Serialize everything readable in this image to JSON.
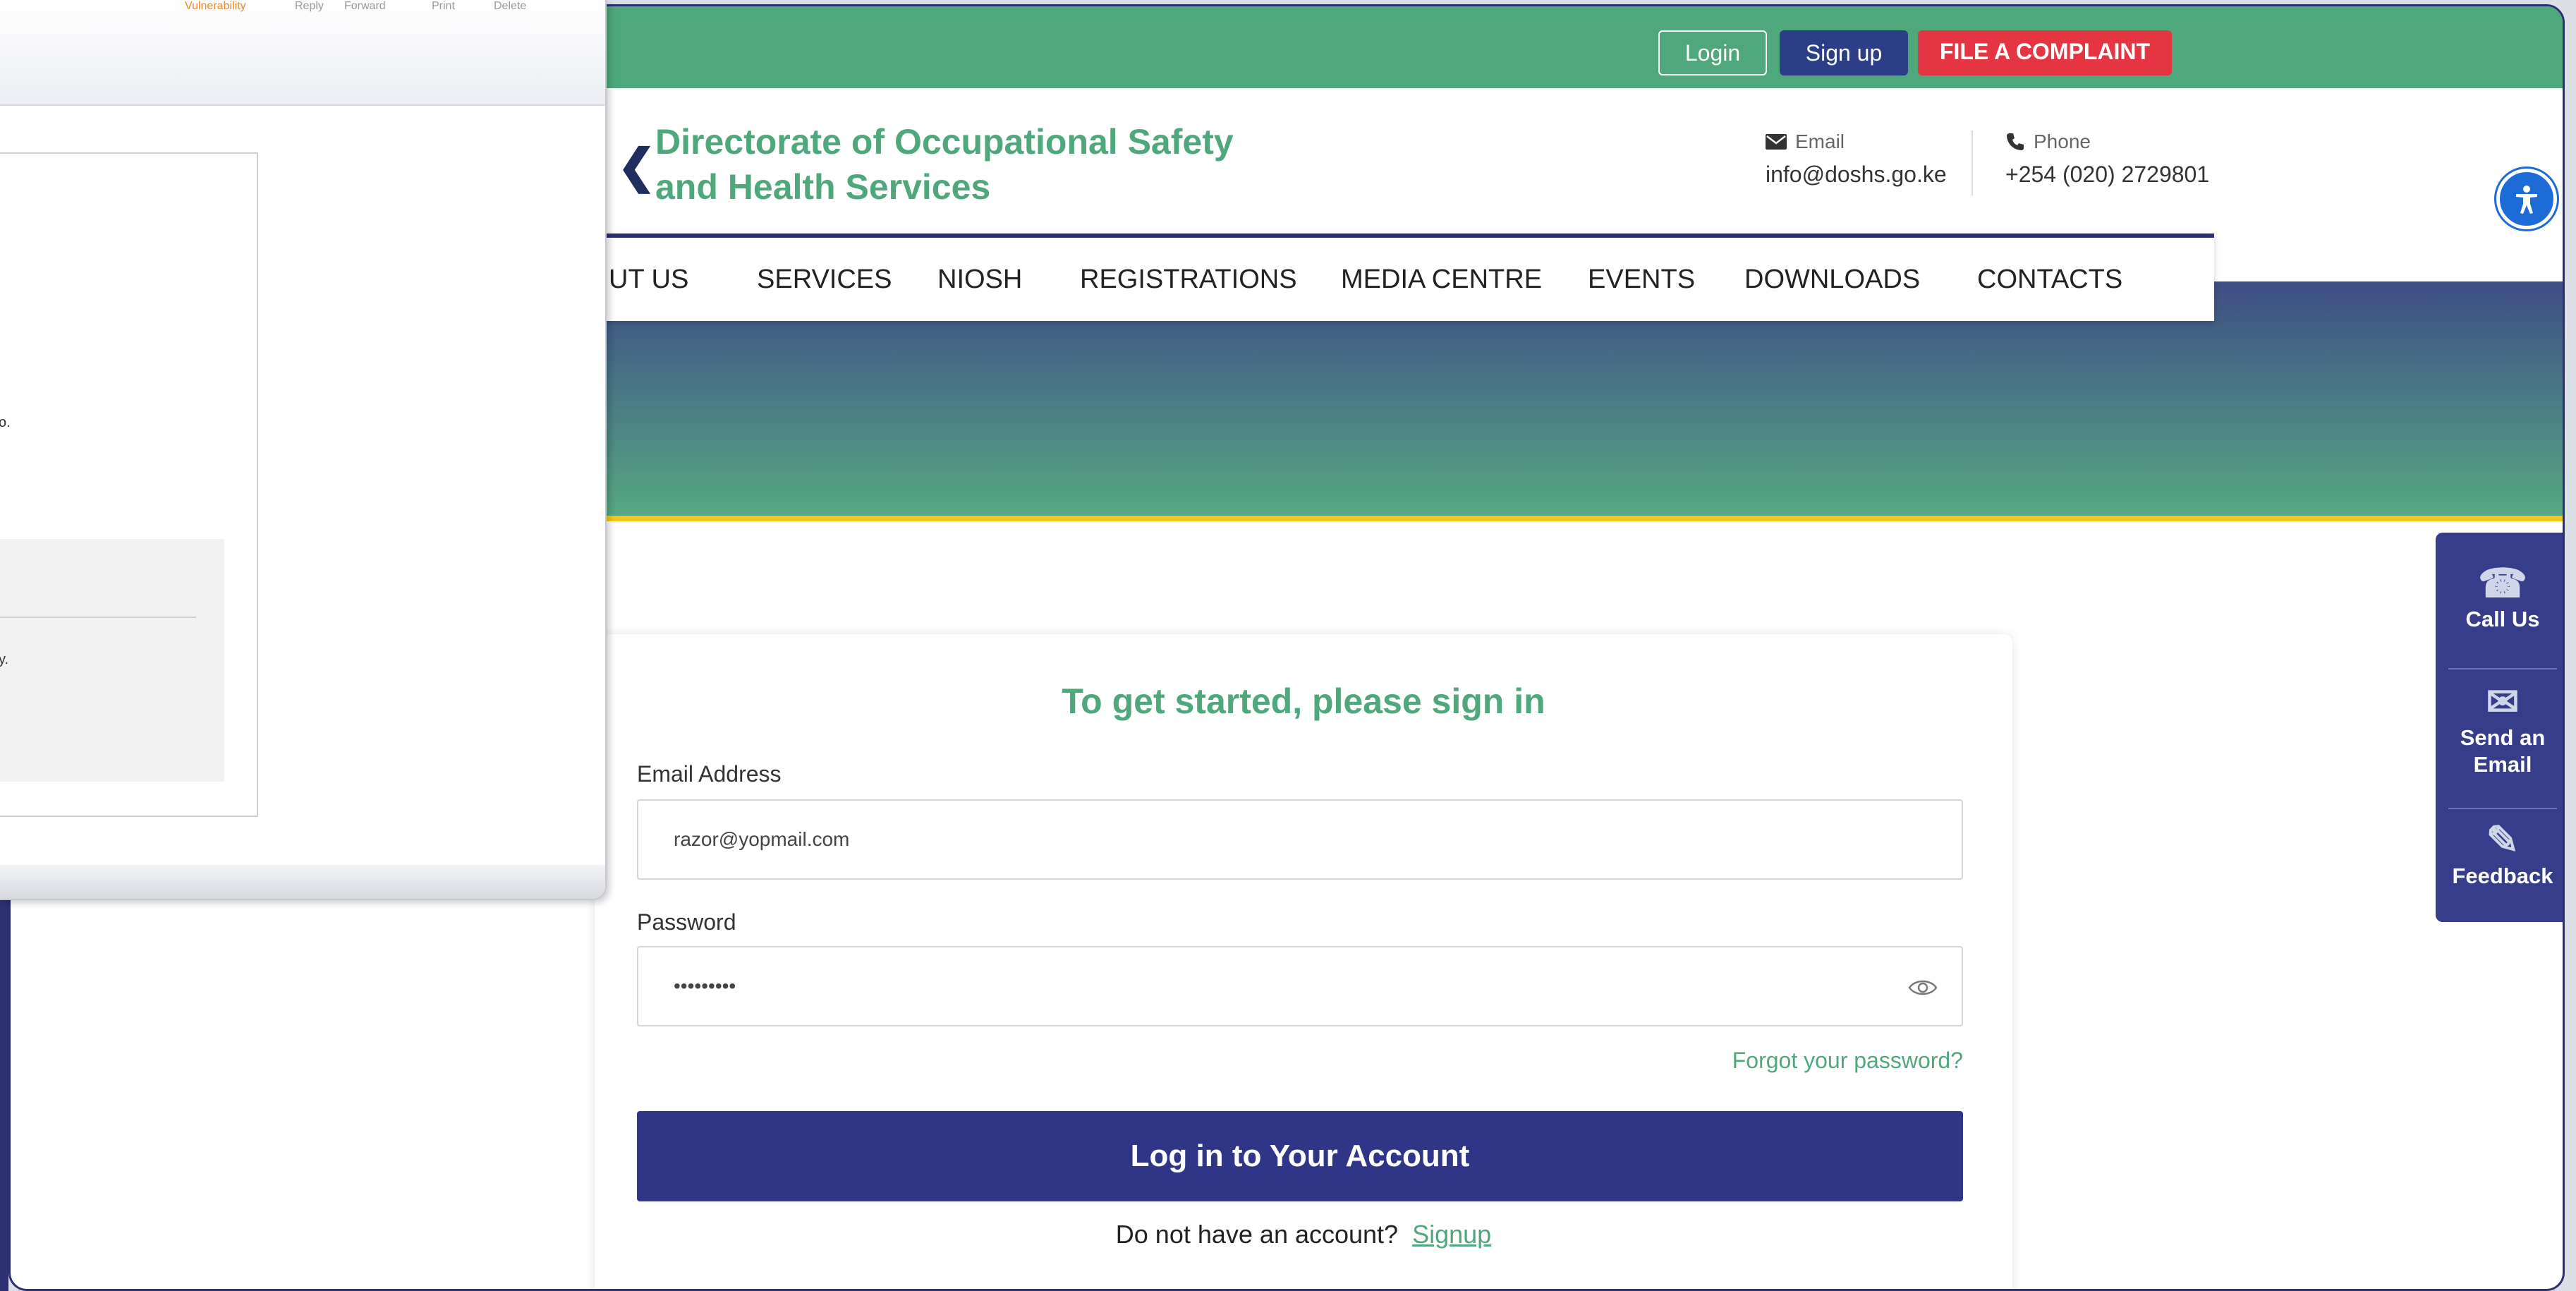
{
  "colors": {
    "brand_green": "#4fa77c",
    "brand_navy": "#2f3687",
    "complaint_red": "#e53542",
    "accent_yellow": "#f2c81c"
  },
  "topbar": {
    "login_label": "Login",
    "signup_label": "Sign up",
    "complaint_label": "FILE A COMPLAINT"
  },
  "header": {
    "org_line1": "Directorate of Occupational Safety",
    "org_line2": "and Health Services",
    "email_label": "Email",
    "email_value": "info@doshs.go.ke",
    "phone_label": "Phone",
    "phone_value": "+254 (020) 2729801"
  },
  "nav": {
    "items": [
      "UT US",
      "SERVICES",
      "NIOSH",
      "REGISTRATIONS",
      "MEDIA CENTRE",
      "EVENTS",
      "DOWNLOADS",
      "CONTACTS"
    ]
  },
  "side_widget": {
    "call_label": "Call Us",
    "email_label_1": "Send an",
    "email_label_2": "Email",
    "feedback_label": "Feedback"
  },
  "login_form": {
    "title": "To get started, please sign in",
    "email_label": "Email Address",
    "email_value": "razor@yopmail.com",
    "password_label": "Password",
    "password_value": "•••••••••",
    "forgot_label": "Forgot your password?",
    "submit_label": "Log in to Your Account",
    "no_account_text": "Do not have an account?",
    "signup_link": "Signup"
  },
  "mail_window": {
    "toolbar": {
      "vulnerability": "Vulnerability",
      "reply": "Reply",
      "forward": "Forward",
      "print": "Print",
      "delete": "Delete"
    },
    "frag1": "o.",
    "frag2": "y."
  }
}
